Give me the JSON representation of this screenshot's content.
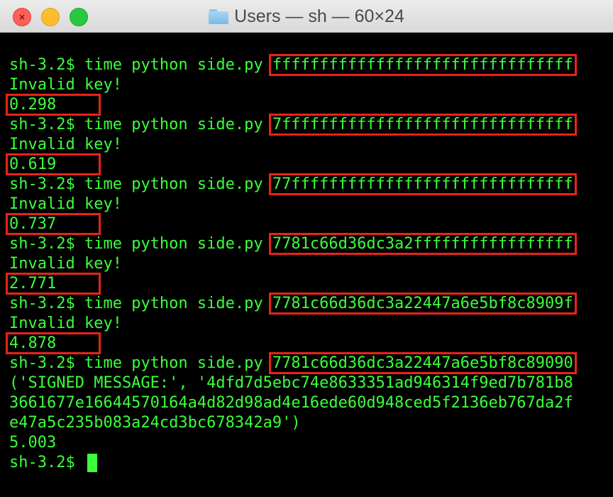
{
  "window": {
    "title": "Users — sh — 60×24",
    "folder_icon": "folder-icon",
    "buttons": [
      "close",
      "minimize",
      "zoom"
    ]
  },
  "terminal": {
    "text_color": "#3bff3b",
    "background_color": "#000000",
    "highlight_color": "#e8231a",
    "lines": [
      {
        "prompt": "sh-3.2$ ",
        "command": "time python side.py ",
        "arg": "ffffffffffffffffffffffffffffffff"
      },
      {
        "text": "Invalid key!"
      },
      {
        "time": "0.298"
      },
      {
        "prompt": "sh-3.2$ ",
        "command": "time python side.py ",
        "arg": "7fffffffffffffffffffffffffffffff"
      },
      {
        "text": "Invalid key!"
      },
      {
        "time": "0.619"
      },
      {
        "prompt": "sh-3.2$ ",
        "command": "time python side.py ",
        "arg": "77ffffffffffffffffffffffffffffff"
      },
      {
        "text": "Invalid key!"
      },
      {
        "time": "0.737"
      },
      {
        "prompt": "sh-3.2$ ",
        "command": "time python side.py ",
        "arg": "7781c66d36dc3a2fffffffffffffffff"
      },
      {
        "text": "Invalid key!"
      },
      {
        "time": "2.771"
      },
      {
        "prompt": "sh-3.2$ ",
        "command": "time python side.py ",
        "arg": "7781c66d36dc3a22447a6e5bf8c8909f"
      },
      {
        "text": "Invalid key!"
      },
      {
        "time": "4.878"
      },
      {
        "prompt": "sh-3.2$ ",
        "command": "time python side.py ",
        "arg": "7781c66d36dc3a22447a6e5bf8c89090"
      },
      {
        "text": "('SIGNED MESSAGE:', '4dfd7d5ebc74e8633351ad946314f9ed7b781b8"
      },
      {
        "text": "3661677e16644570164a4d82d98ad4e16ede60d948ced5f2136eb767da2f"
      },
      {
        "text": "e47a5c235b083a24cd3bc678342a9')"
      },
      {
        "text": "5.003"
      },
      {
        "prompt": "sh-3.2$ ",
        "cursor": true
      }
    ]
  }
}
